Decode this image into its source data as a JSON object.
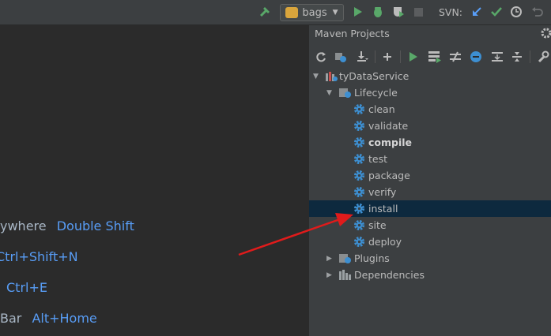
{
  "toolbar": {
    "run_config": "bags",
    "svn_label": "SVN:"
  },
  "editor": {
    "hints": [
      {
        "text": "ywhere",
        "key": "Double Shift"
      },
      {
        "text": "",
        "key": "Ctrl+Shift+N"
      },
      {
        "text": "",
        "key": "Ctrl+E"
      },
      {
        "text": "Bar",
        "key": "Alt+Home"
      }
    ]
  },
  "maven": {
    "title": "Maven Projects",
    "project": "tyDataService",
    "lifecycle_label": "Lifecycle",
    "phases": [
      "clean",
      "validate",
      "compile",
      "test",
      "package",
      "verify",
      "install",
      "site",
      "deploy"
    ],
    "selected_phase": "install",
    "bold_phase": "compile",
    "plugins_label": "Plugins",
    "dependencies_label": "Dependencies"
  },
  "colors": {
    "accent_blue": "#589df6",
    "run_green": "#59a869",
    "arrow_red": "#e01b1b",
    "gear_blue": "#3d8fd1"
  }
}
